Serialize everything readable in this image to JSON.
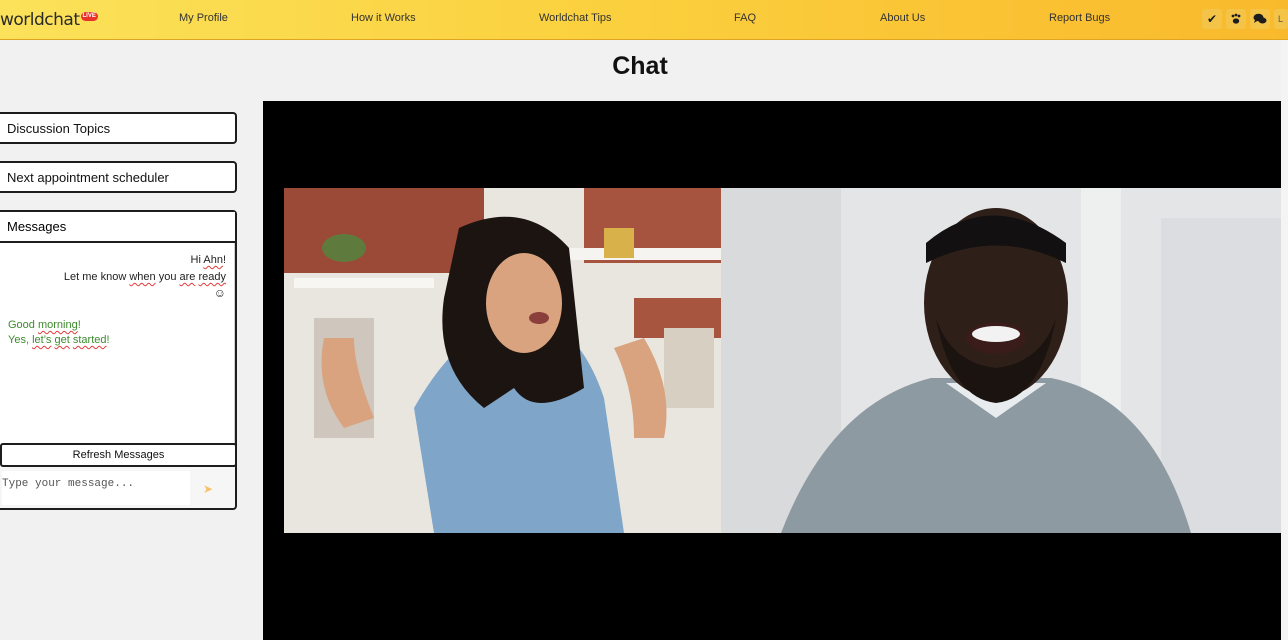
{
  "app": {
    "logo_text": "worldchat",
    "logo_badge": "LIVE"
  },
  "nav": {
    "items": [
      {
        "label": "My Profile"
      },
      {
        "label": "How it Works"
      },
      {
        "label": "Worldchat Tips"
      },
      {
        "label": "FAQ"
      },
      {
        "label": "About Us"
      },
      {
        "label": "Report Bugs"
      }
    ],
    "icons": [
      "checkmark-icon",
      "paw-icon",
      "chat-bubbles-icon"
    ],
    "partial_label": "L"
  },
  "page": {
    "title": "Chat"
  },
  "sidebar": {
    "discussion_topics": "Discussion Topics",
    "scheduler": "Next appointment scheduler",
    "messages": {
      "header": "Messages",
      "incoming": {
        "line1_a": "Hi ",
        "line1_b": "Ahn",
        "line1_c": "!",
        "line2_a": "Let me know ",
        "line2_b": "when",
        "line2_c": " you ",
        "line2_d": "are",
        "line2_e": " ",
        "line2_f": "ready",
        "emoji": "☺"
      },
      "outgoing": {
        "line1_a": "Good ",
        "line1_b": "morning",
        "line1_c": "!",
        "line2_a": "Yes, ",
        "line2_b": "let’s",
        "line2_c": " ",
        "line2_d": "get",
        "line2_e": " ",
        "line2_f": "started",
        "line2_g": "!"
      },
      "refresh_label": "Refresh Messages",
      "input_placeholder": "Type your message...",
      "send_icon": "send-arrow-icon"
    }
  },
  "colors": {
    "topbar_start": "#fbe25a",
    "topbar_end": "#f9b92c",
    "outgoing_text": "#3c8a2e",
    "send_arrow": "#f6c36a"
  }
}
